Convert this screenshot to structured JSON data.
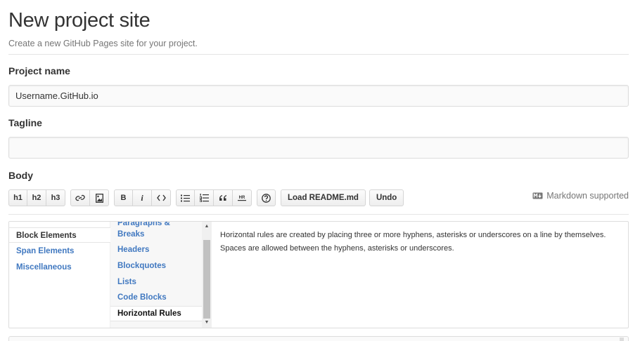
{
  "page": {
    "title": "New project site",
    "subtitle": "Create a new GitHub Pages site for your project."
  },
  "form": {
    "project_name": {
      "label": "Project name",
      "value": "Username.GitHub.io"
    },
    "tagline": {
      "label": "Tagline",
      "value": ""
    },
    "body": {
      "label": "Body"
    }
  },
  "toolbar": {
    "h1": "h1",
    "h2": "h2",
    "h3": "h3",
    "link_icon": "link-icon",
    "image_icon": "image-icon",
    "bold": "B",
    "italic": "i",
    "code_icon": "code-icon",
    "bullet_list_icon": "bullet-list-icon",
    "numbered_list_icon": "numbered-list-icon",
    "quote_icon": "quote-icon",
    "hr_icon": "horizontal-rule-icon",
    "help_icon": "help-icon",
    "load_readme": "Load README.md",
    "undo": "Undo",
    "markdown_supported": "Markdown supported"
  },
  "help": {
    "categories": [
      "Block Elements",
      "Span Elements",
      "Miscellaneous"
    ],
    "active_category": "Block Elements",
    "topics": [
      "Paragraphs &",
      "Breaks",
      "Headers",
      "Blockquotes",
      "Lists",
      "Code Blocks",
      "Horizontal Rules"
    ],
    "active_topic": "Horizontal Rules",
    "content": [
      "Horizontal rules are created by placing three or more hyphens, asterisks or underscores on a line by themselves.",
      "Spaces are allowed between the hyphens, asterisks or underscores."
    ]
  },
  "colors": {
    "link": "#4078c0",
    "text": "#333333",
    "muted": "#767676",
    "border": "#dddddd"
  }
}
